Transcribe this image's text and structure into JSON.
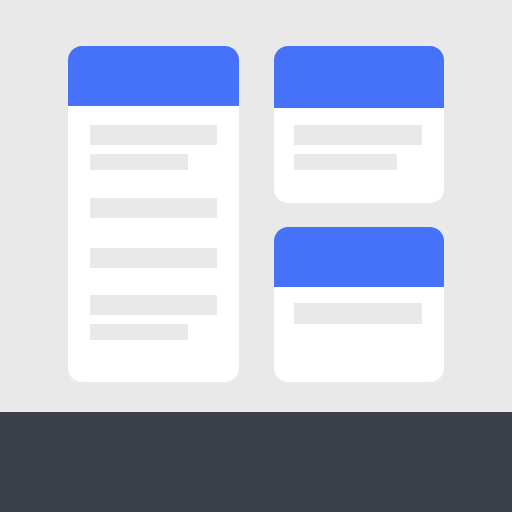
{
  "colors": {
    "background": "#e9e9ea",
    "card": "#ffffff",
    "header_accent": "#4672f9",
    "placeholder": "#e9e9ea",
    "bottom_panel": "#3c4048"
  },
  "icons": [
    "column-card-icon",
    "column-card-icon",
    "column-card-icon"
  ],
  "cards": [
    {
      "placeholder_lines": 6
    },
    {
      "placeholder_lines": 2
    },
    {
      "placeholder_lines": 1
    }
  ]
}
